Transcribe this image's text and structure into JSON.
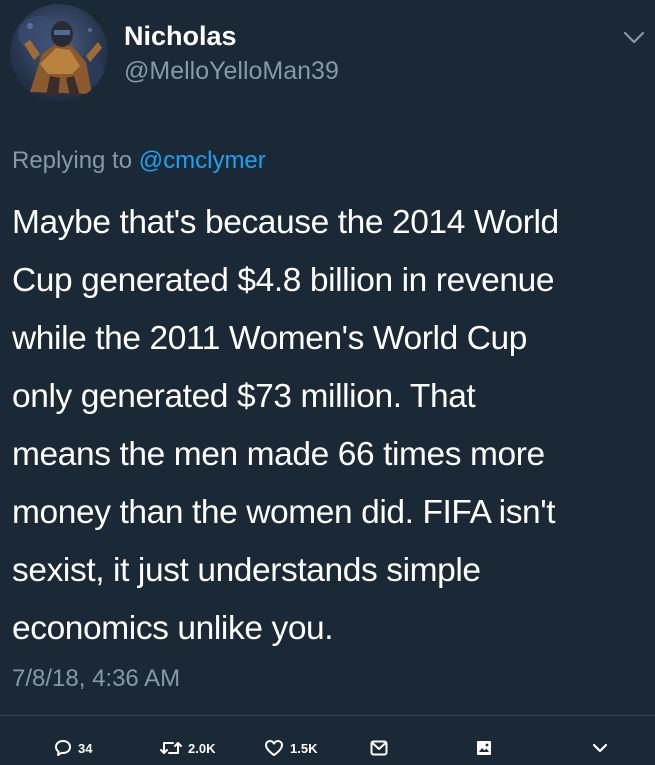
{
  "user": {
    "display_name": "Nicholas",
    "handle": "@MelloYelloMan39",
    "avatar": "avatar-image"
  },
  "reply": {
    "prefix": "Replying to",
    "mention": "@cmclymer"
  },
  "tweet": {
    "lines": [
      "Maybe that's because the 2014 World",
      "Cup generated $4.8 billion in revenue",
      "while the 2011 Women's World Cup",
      "only generated $73 million. That",
      "means the men made 66 times more",
      "money than the women did. FIFA isn't",
      "sexist, it just understands simple",
      "economics unlike you."
    ],
    "timestamp": "7/8/18, 4:36 AM"
  },
  "actions": {
    "reply_count": "34",
    "retweet_count": "2.0K",
    "like_count": "1.5K"
  },
  "icons": {
    "menu": "chevron-down-icon",
    "reply": "reply-bubble-icon",
    "retweet": "retweet-icon",
    "like": "heart-icon",
    "dm": "envelope-icon",
    "media": "image-icon",
    "more": "chevron-down-icon"
  },
  "colors": {
    "background": "#1b2836",
    "text": "#ffffff",
    "secondary": "#8899a6",
    "link": "#1da1f2",
    "divider": "#38444d"
  }
}
